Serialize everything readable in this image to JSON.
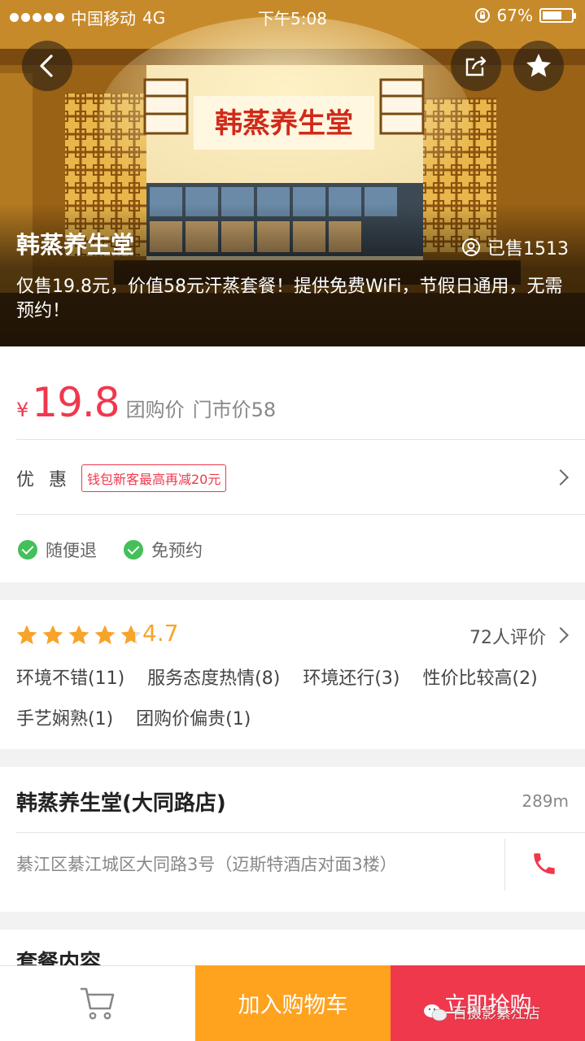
{
  "status_bar": {
    "carrier": "中国移动",
    "network": "4G",
    "time": "下午5:08",
    "battery": "67%",
    "battery_level": 0.67
  },
  "hero": {
    "title": "韩蒸养生堂",
    "sign_text": "韩蒸养生堂",
    "sold": "已售1513",
    "description": "仅售19.8元，价值58元汗蒸套餐！提供免费WiFi，节假日通用，无需预约！"
  },
  "price": {
    "symbol": "¥",
    "value": "19.8",
    "tag": "团购价",
    "market": "门市价58"
  },
  "promo": {
    "label": "优惠",
    "badge": "钱包新客最高再减20元"
  },
  "guarantees": [
    "随便退",
    "免预约"
  ],
  "rating": {
    "stars": 4.7,
    "score": "4.7",
    "count": "72人评价",
    "tags": [
      "环境不错(11)",
      "服务态度热情(8)",
      "环境还行(3)",
      "性价比较高(2)",
      "手艺娴熟(1)",
      "团购价偏贵(1)"
    ]
  },
  "shop": {
    "name": "韩蒸养生堂(大同路店)",
    "distance": "289m",
    "address": "綦江区綦江城区大同路3号（迈斯特酒店对面3楼）"
  },
  "package": {
    "title": "套餐内容"
  },
  "bottom_bar": {
    "add_cart": "加入购物车",
    "buy_now": "立即抢购"
  },
  "watermark": "百摄影綦江店",
  "colors": {
    "accent": "#f0384d",
    "orange": "#ffa21e",
    "star": "#f7a42b",
    "check": "#43c05a"
  },
  "icons": [
    "back-icon",
    "share-icon",
    "star-icon",
    "user-icon",
    "chevron-right-icon",
    "check-icon",
    "cart-icon",
    "phone-icon",
    "wechat-icon"
  ]
}
